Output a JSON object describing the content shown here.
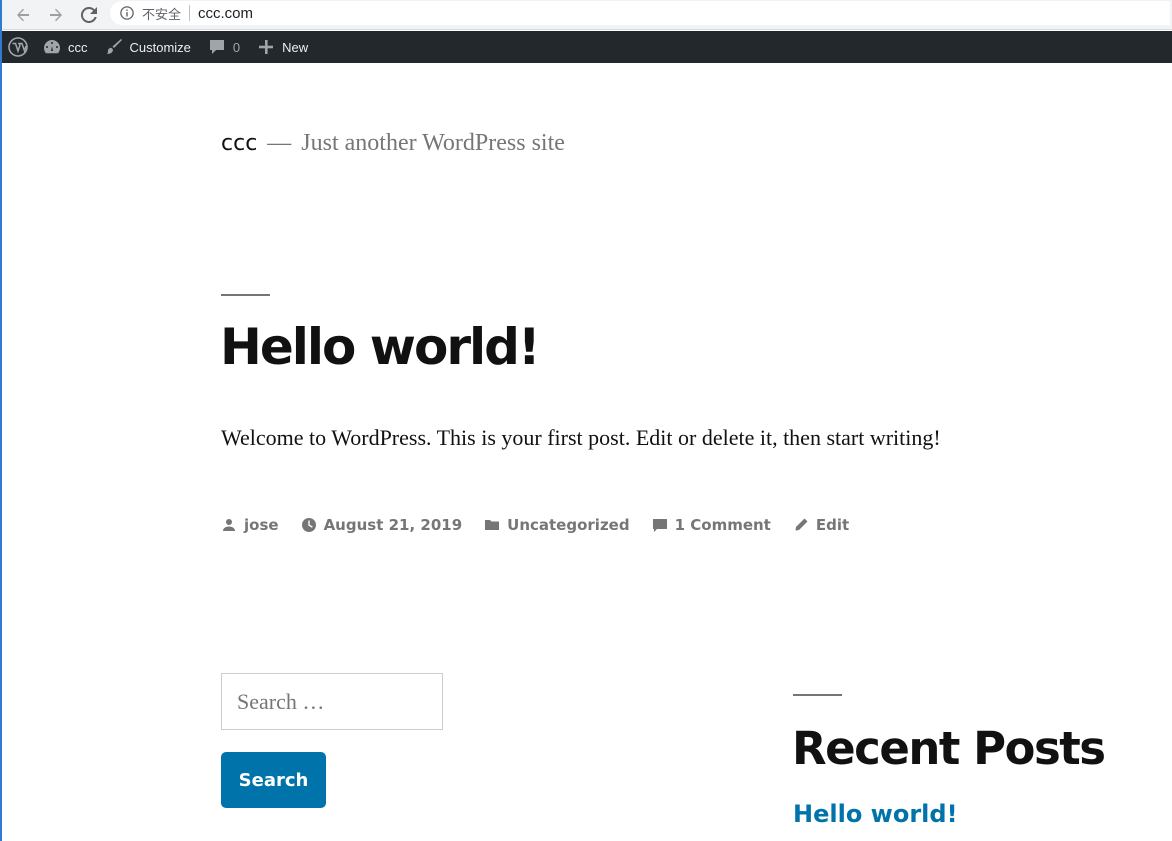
{
  "browser": {
    "security_label": "不安全",
    "url": "ccc.com"
  },
  "admin_bar": {
    "site_name": "ccc",
    "customize_label": "Customize",
    "comments_count": "0",
    "new_label": "New"
  },
  "site": {
    "title": "ccc",
    "dash": "—",
    "description": "Just another WordPress site"
  },
  "post": {
    "title": "Hello world!",
    "content": "Welcome to WordPress. This is your first post. Edit or delete it, then start writing!",
    "meta": {
      "author": "jose",
      "date": "August 21, 2019",
      "category": "Uncategorized",
      "comments": "1 Comment",
      "edit": "Edit"
    }
  },
  "search_widget": {
    "placeholder": "Search …",
    "button_label": "Search"
  },
  "recent_posts": {
    "title": "Recent Posts",
    "items": [
      "Hello world!"
    ]
  },
  "colors": {
    "accent": "#0073aa",
    "admin_bar_bg": "#23282d",
    "meta_gray": "#767676"
  }
}
